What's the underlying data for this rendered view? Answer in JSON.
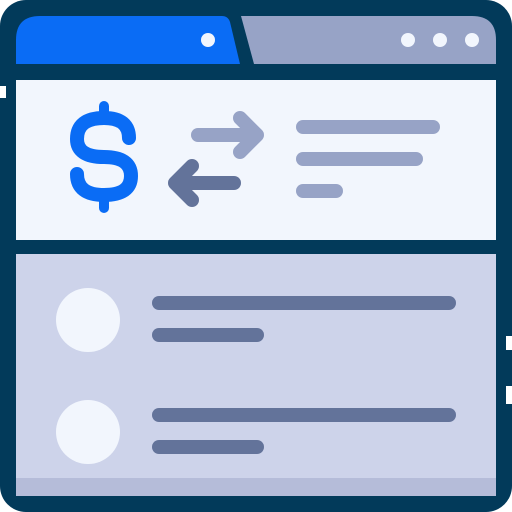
{
  "icon": {
    "name": "online-money-transfer-browser-icon",
    "symbols": {
      "currency": "$"
    },
    "colors": {
      "outline": "#023a5a",
      "active_tab": "#0a6cf5",
      "inactive_tab": "#97a3c6",
      "header_panel": "#f2f6fd",
      "list_panel": "#cdd3ea",
      "list_panel_shadow": "#b5bcd9",
      "avatar": "#f2f6fd",
      "list_line": "#63739a",
      "header_line": "#97a3c6",
      "arrow_right": "#97a3c6",
      "arrow_left": "#63739a",
      "dots": "#f2f6fd",
      "white": "#ffffff"
    },
    "window_dots": 3,
    "list_items": 2
  }
}
